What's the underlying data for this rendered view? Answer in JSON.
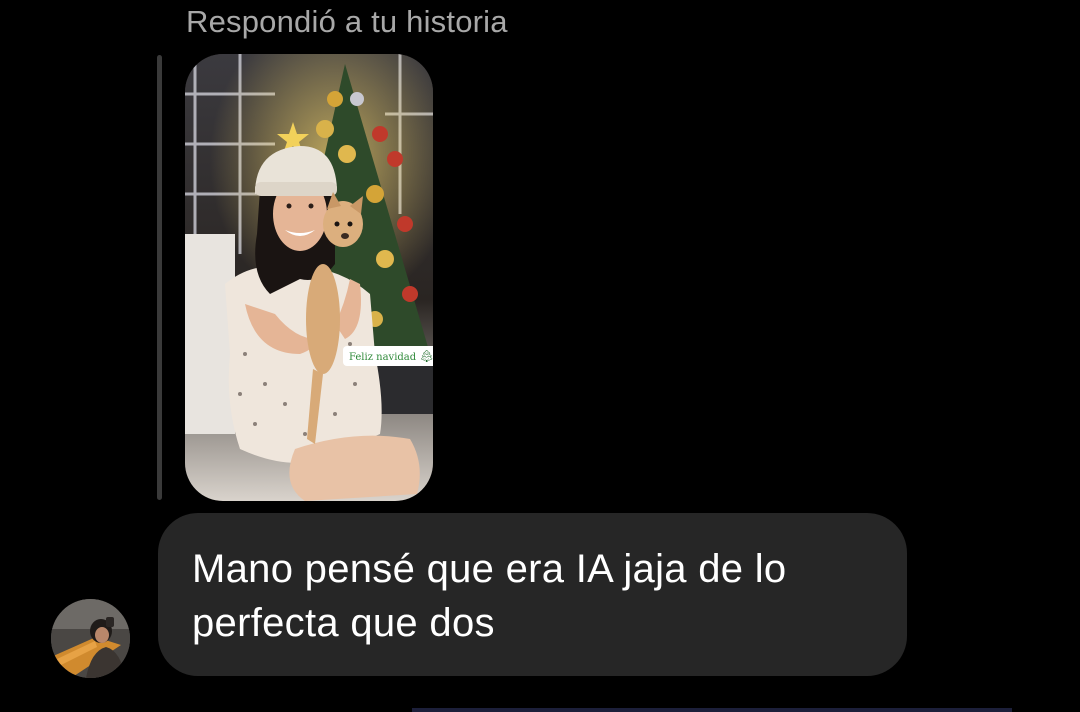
{
  "reply": {
    "header": "Respondió a tu historia"
  },
  "story": {
    "sticker_text": "Feliz navidad",
    "sticker_icon": "christmas-tree-icon",
    "photo_description_icon": "story-photo"
  },
  "message": {
    "text": "Mano pensé que era IA jaja de lo perfecta que dos"
  },
  "sender": {
    "avatar_icon": "profile-avatar"
  },
  "colors": {
    "background": "#000000",
    "bubble": "#262626",
    "header_text": "#a8a8a8",
    "quote_bar": "#3a3a3a"
  }
}
